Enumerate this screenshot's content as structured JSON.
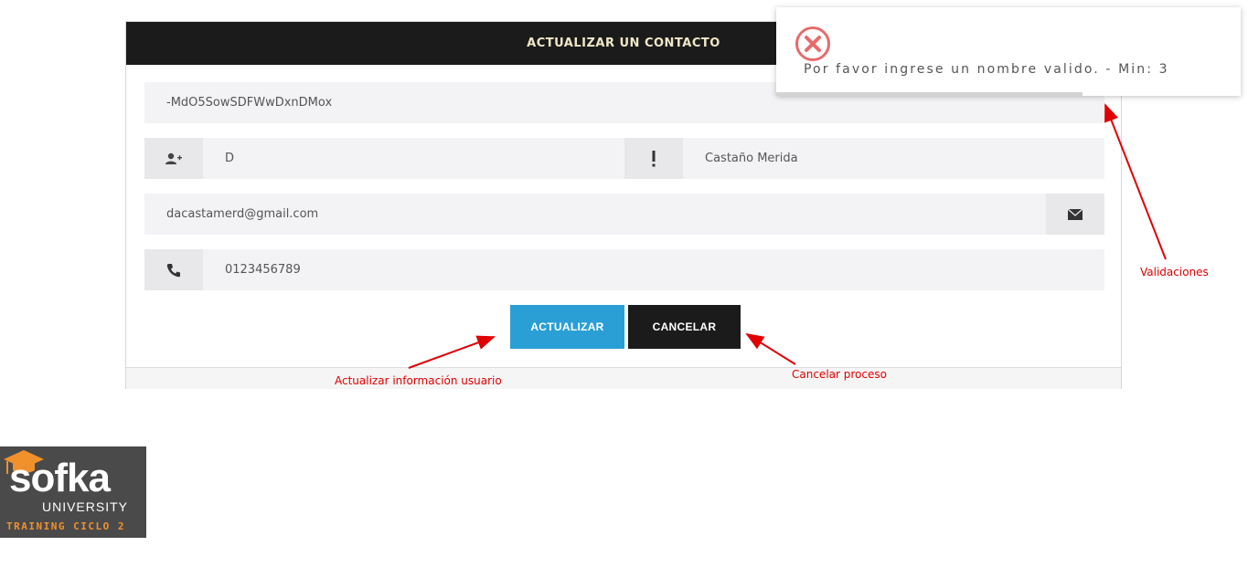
{
  "form": {
    "title": "ACTUALIZAR UN CONTACTO",
    "id_value": "-MdO5SowSDFWwDxnDMox",
    "first_name": "D",
    "last_name": "Castaño Merida",
    "email": "dacastamerd@gmail.com",
    "phone": "0123456789",
    "update_label": "ACTUALIZAR",
    "cancel_label": "CANCELAR"
  },
  "toast": {
    "message": "Por favor ingrese un nombre valido. - Min: 3",
    "icon": "error-circle-x-icon",
    "accent": "#e86a6a",
    "progress_remaining": 0.66
  },
  "annotations": {
    "validations": "Validaciones",
    "update_info": "Actualizar información usuario",
    "cancel_process": "Cancelar proceso"
  },
  "logo": {
    "brand": "sofka",
    "university": "UNIVERSITY",
    "training": "TRAINING CICLO 2"
  },
  "colors": {
    "header_bg": "#1b1b1b",
    "update_button": "#2a9fd6",
    "cancel_button": "#1b1b1b",
    "annotation": "#e00000",
    "logo_accent": "#f0912c"
  }
}
